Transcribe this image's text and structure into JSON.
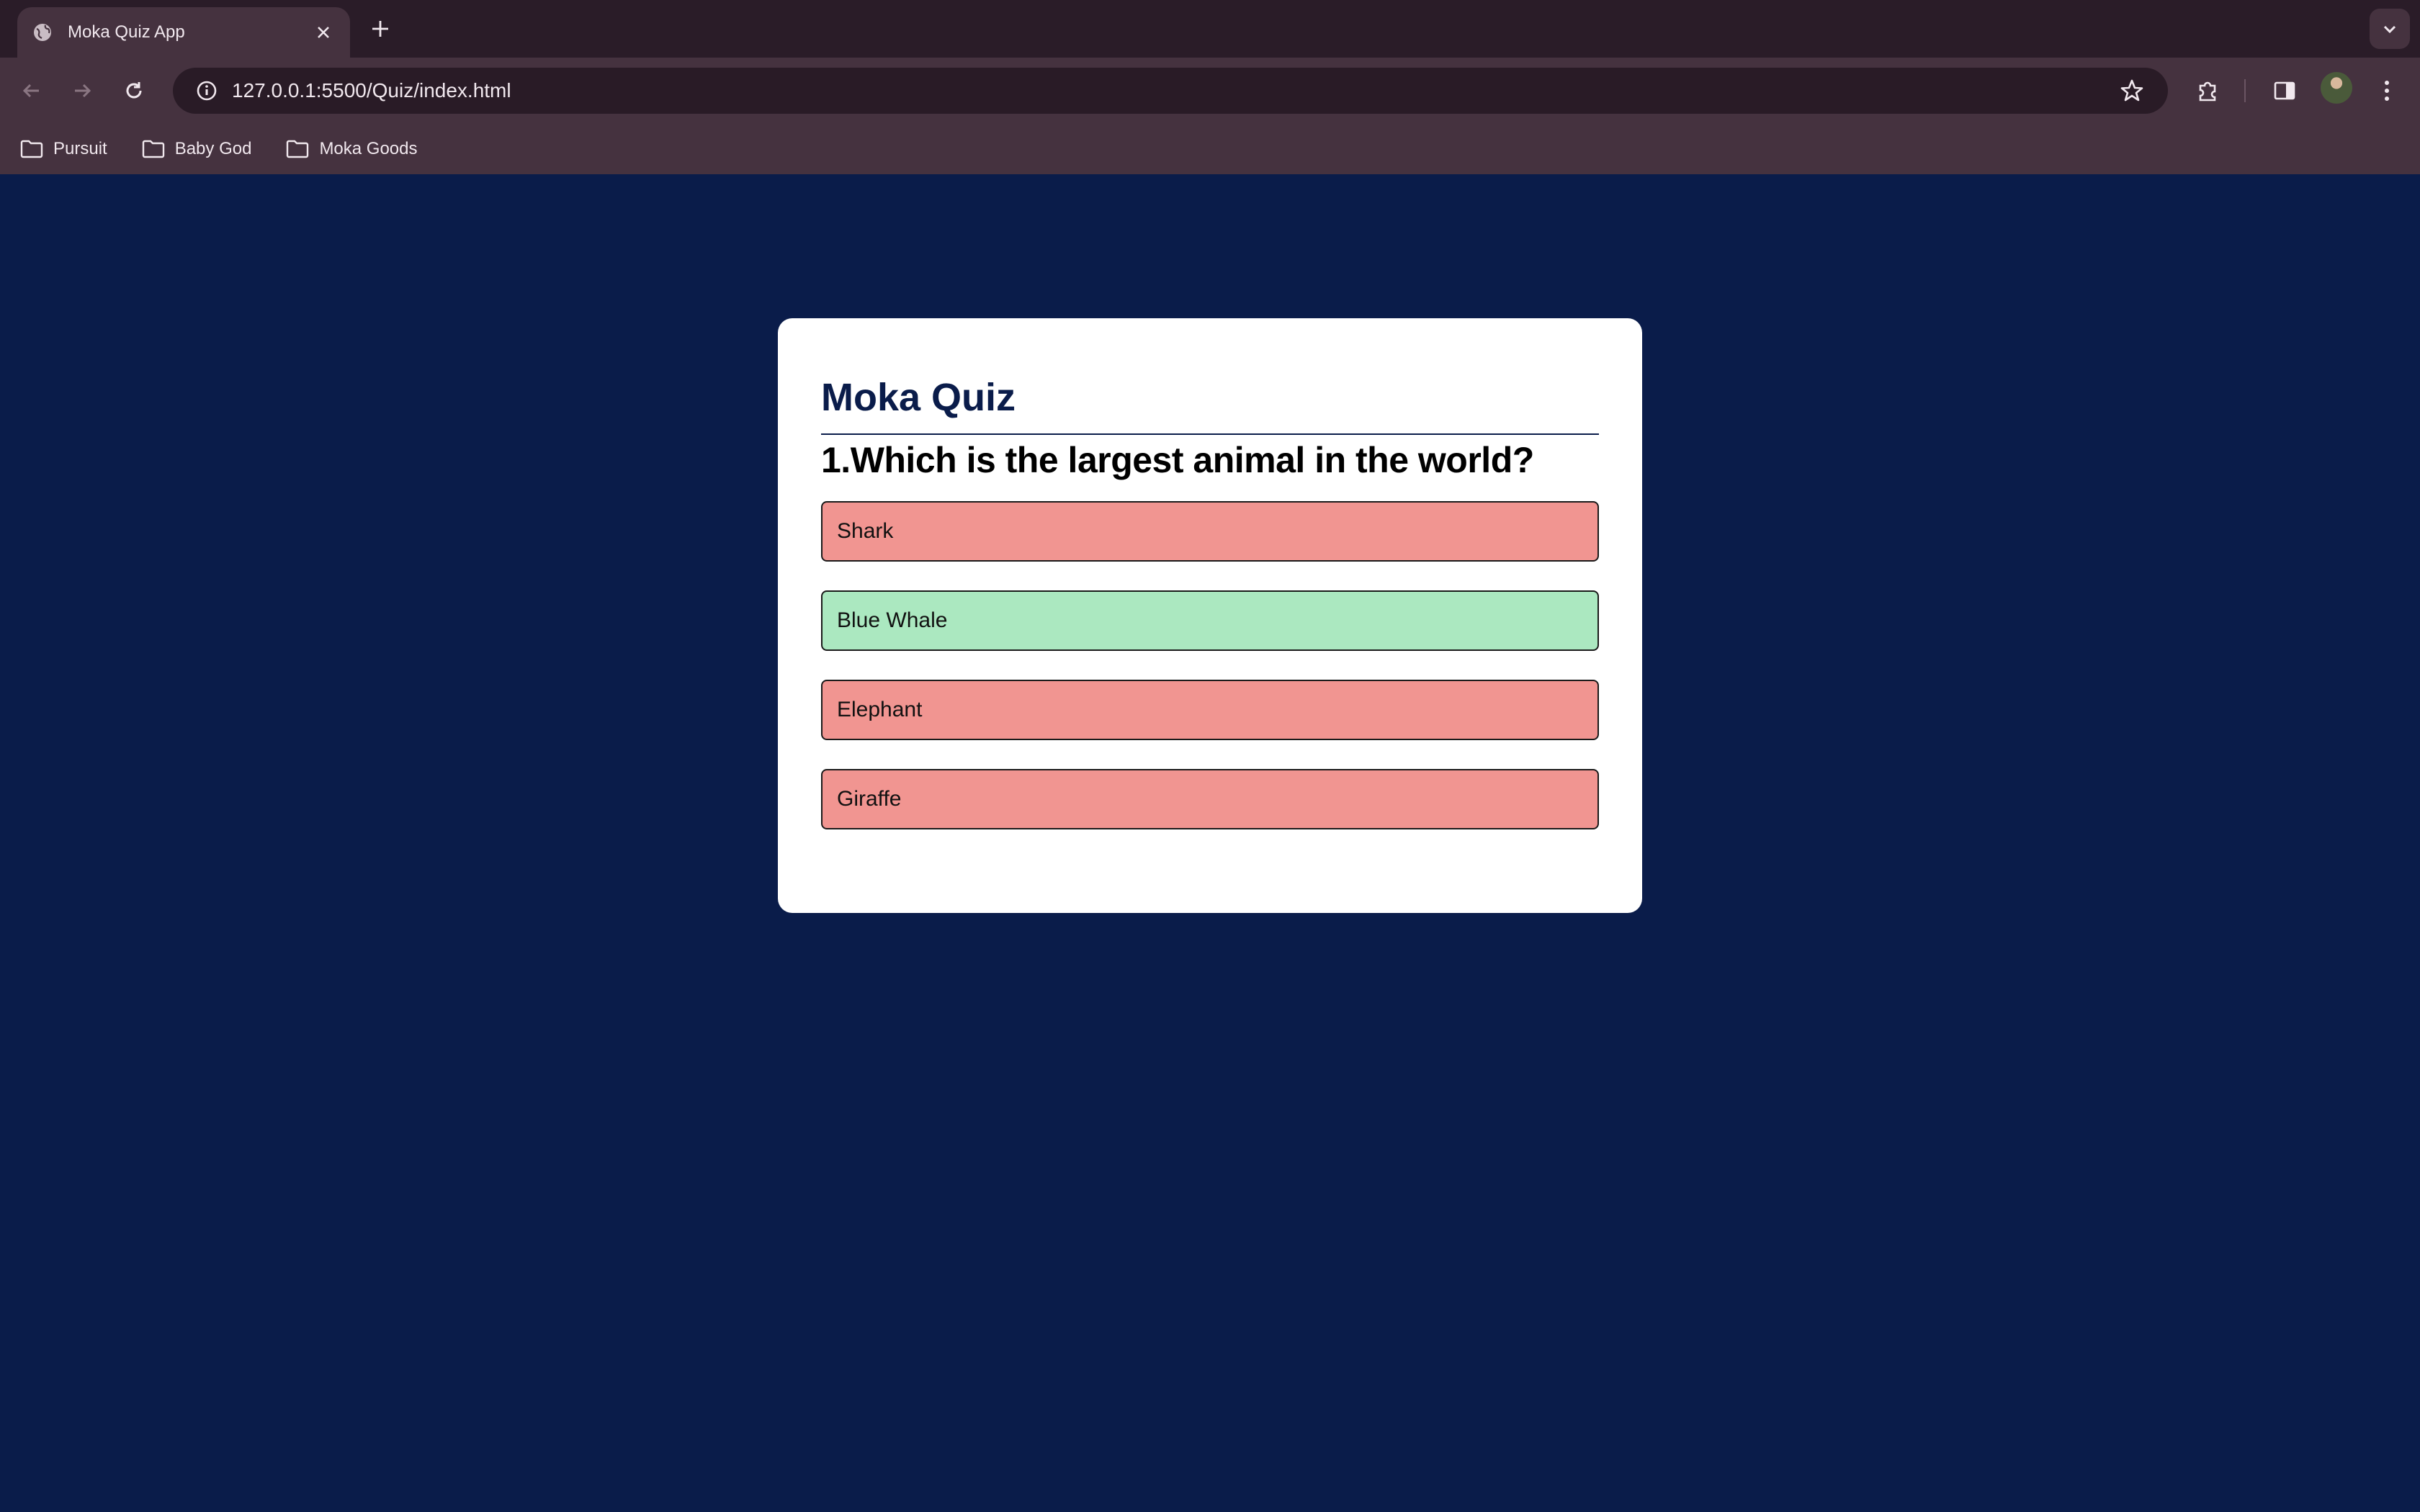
{
  "browser": {
    "tab": {
      "title": "Moka Quiz App"
    },
    "address_bar": {
      "url": "127.0.0.1:5500/Quiz/index.html"
    },
    "bookmarks": [
      {
        "label": "Pursuit"
      },
      {
        "label": "Baby God"
      },
      {
        "label": "Moka Goods"
      }
    ]
  },
  "quiz": {
    "app_title": "Moka Quiz",
    "question": "1.Which is the largest animal in the world?",
    "answers": [
      {
        "label": "Shark",
        "state": "incorrect"
      },
      {
        "label": "Blue Whale",
        "state": "correct"
      },
      {
        "label": "Elephant",
        "state": "incorrect"
      },
      {
        "label": "Giraffe",
        "state": "incorrect"
      }
    ]
  },
  "colors": {
    "page_background": "#0a1c4a",
    "correct": "#abe8c0",
    "incorrect": "#f19591",
    "title": "#0a1c4a"
  }
}
